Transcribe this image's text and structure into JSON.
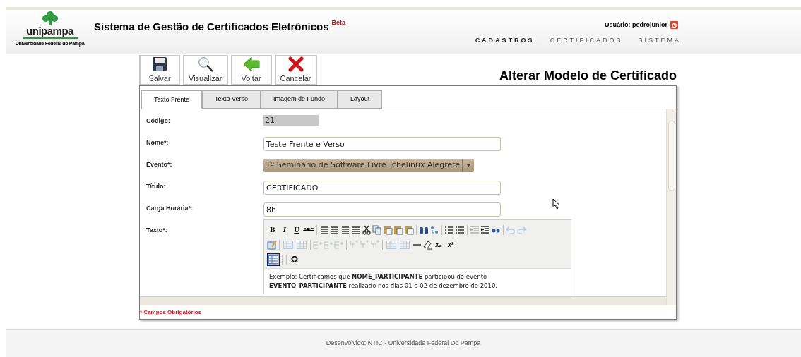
{
  "header": {
    "logo": {
      "name": "unipampa",
      "subtitle": "Universidade Federal do Pampa"
    },
    "title": "Sistema de Gestão de Certificados Eletrônicos",
    "badge": "Beta",
    "user": "Usuário: pedrojunior",
    "menu": [
      {
        "label": "CADASTROS",
        "selected": true
      },
      {
        "label": "CERTIFICADOS",
        "selected": false
      },
      {
        "label": "SISTEMA",
        "selected": false
      }
    ]
  },
  "toolbar": [
    {
      "kind": "save",
      "label": "Salvar"
    },
    {
      "kind": "view",
      "label": "Visualizar"
    },
    {
      "kind": "back",
      "label": "Voltar"
    },
    {
      "kind": "cancel",
      "label": "Cancelar"
    }
  ],
  "page_title": "Alterar Modelo de Certificado",
  "tabs": [
    {
      "label": "Texto Frente",
      "selected": true
    },
    {
      "label": "Texto Verso",
      "selected": false
    },
    {
      "label": "Imagem de Fundo",
      "selected": false
    },
    {
      "label": "Layout",
      "selected": false
    }
  ],
  "form": [
    {
      "kind": "readonly",
      "label": "Código:",
      "value": "21"
    },
    {
      "kind": "text",
      "label": "Nome*:",
      "value": "Teste Frente e Verso"
    },
    {
      "kind": "select",
      "label": "Evento*:",
      "value": "1º Seminário de Software Livre Tchelinux Alegrete",
      "arrow": "▼"
    },
    {
      "kind": "text",
      "label": "Título:",
      "value": "CERTIFICADO"
    },
    {
      "kind": "text",
      "label": "Carga Horária*:",
      "value": "8h"
    },
    {
      "kind": "editor",
      "label": "Texto*:"
    }
  ],
  "editor": {
    "buttons": [
      {
        "kind": "bold",
        "label": "B",
        "disabled": false
      },
      {
        "kind": "italic",
        "label": "I",
        "disabled": false
      },
      {
        "kind": "underline",
        "label": "U",
        "disabled": false
      },
      {
        "kind": "strike",
        "label": "ABC",
        "disabled": false
      },
      {
        "kind": "sep"
      },
      {
        "kind": "align",
        "disabled": false
      },
      {
        "kind": "align",
        "disabled": false
      },
      {
        "kind": "align",
        "disabled": false
      },
      {
        "kind": "align",
        "disabled": false
      },
      {
        "kind": "cut",
        "disabled": false
      },
      {
        "kind": "copy",
        "disabled": false
      },
      {
        "kind": "paste",
        "disabled": false
      },
      {
        "kind": "paste",
        "disabled": false
      },
      {
        "kind": "paste",
        "disabled": false
      },
      {
        "kind": "sep"
      },
      {
        "kind": "find",
        "disabled": false
      },
      {
        "kind": "replace",
        "disabled": false
      },
      {
        "kind": "sep"
      },
      {
        "kind": "list",
        "disabled": false
      },
      {
        "kind": "list",
        "disabled": false
      },
      {
        "kind": "sep"
      },
      {
        "kind": "indent",
        "disabled": true
      },
      {
        "kind": "indent",
        "disabled": false
      },
      {
        "kind": "quote",
        "disabled": false
      },
      {
        "kind": "sep"
      },
      {
        "kind": "undo",
        "disabled": true
      },
      {
        "kind": "redo",
        "disabled": true
      },
      {
        "kind": "break"
      },
      {
        "kind": "code",
        "disabled": false
      },
      {
        "kind": "sep"
      },
      {
        "kind": "table",
        "disabled": true,
        "selected": false
      },
      {
        "kind": "table",
        "disabled": true,
        "selected": false
      },
      {
        "kind": "sep"
      },
      {
        "kind": "row",
        "disabled": true
      },
      {
        "kind": "row",
        "disabled": true
      },
      {
        "kind": "row",
        "disabled": true
      },
      {
        "kind": "sep"
      },
      {
        "kind": "column",
        "disabled": true
      },
      {
        "kind": "column",
        "disabled": true
      },
      {
        "kind": "column",
        "disabled": true
      },
      {
        "kind": "sep"
      },
      {
        "kind": "table",
        "disabled": true,
        "selected": false
      },
      {
        "kind": "table",
        "disabled": true,
        "selected": false
      },
      {
        "kind": "rule",
        "disabled": false
      },
      {
        "kind": "eraser",
        "disabled": false
      },
      {
        "kind": "script",
        "label": "x₂",
        "disabled": false
      },
      {
        "kind": "script",
        "label": "x²",
        "disabled": false
      },
      {
        "kind": "break"
      },
      {
        "kind": "table",
        "disabled": false,
        "selected": true
      },
      {
        "kind": "sep"
      },
      {
        "kind": "sep"
      },
      {
        "kind": "symbol",
        "label": "Ω",
        "disabled": false
      }
    ],
    "content": "Exemplo: Certificamos que **NOME_PARTICIPANTE** participou do evento **EVENTO_PARTICIPANTE** realizado nos dias 01 e 02 de dezembro de 2010."
  },
  "required_note": "* Campos Obrigatórios",
  "footer": "Desenvolvido: NTIC - Universidade Federal Do Pampa"
}
